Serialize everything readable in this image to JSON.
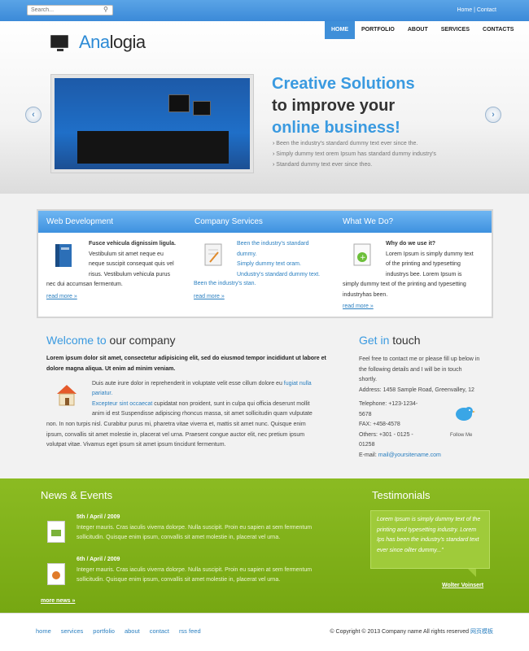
{
  "search": {
    "placeholder": "Search..."
  },
  "toplinks": {
    "home": "Home",
    "sep": " | ",
    "contact": "Contact"
  },
  "logo": {
    "part1": "Ana",
    "part2": "logia"
  },
  "nav": [
    "HOME",
    "PORTFOLIO",
    "ABOUT",
    "SERVICES",
    "CONTACTS"
  ],
  "hero": {
    "line1": "Creative Solutions",
    "line2": "to improve your",
    "line3": "online business!",
    "bullets": [
      "Been the industry's standard dummy text ever since the.",
      "Simply dummy text orem Ipsum has standard dummy industry's",
      "Standard dummy text ever since theo."
    ]
  },
  "box": {
    "web": {
      "title": "Web Development",
      "lead": "Fusce vehicula dignissim ligula.",
      "text1": "Vestibulum sit amet neque eu",
      "text2": "neque suscipit consequat quis vel",
      "text3": "risus. Vestibulum vehicula purus",
      "text4": "nec dui accumsan fermentum.",
      "more": "read more »"
    },
    "company": {
      "title": "Company Services",
      "links": [
        "Been the industry's standard",
        "dummy.",
        "Simply dummy text oram.",
        "Undustry's standard dummy text.",
        "Been the industry's stan."
      ],
      "more": "read more »"
    },
    "what": {
      "title": "What We Do?",
      "lead": "Why do we use it?",
      "text1": "Lorem Ipsum is simply dummy text",
      "text2": "of the printing and typesetting",
      "text3": "industrys bee. Lorem Ipsum is",
      "text4": "simply dummy text of the printing and typesetting",
      "text5": "industryhas been.",
      "more": "read more »"
    }
  },
  "welcome": {
    "title_a": "Welcome to",
    "title_b": " our company",
    "bold1": "Lorem ipsum dolor sit amet, consectetur adipisicing elit, sed do eiusmod tempor incididunt ut labore et",
    "bold2": "dolore magna aliqua. Ut enim ad minim veniam.",
    "p1": "Duis aute irure dolor in reprehenderit in voluptate velit esse cillum dolore eu ",
    "p1link": "fugiat nulla",
    "p1link2": "pariatur.",
    "p2link": "Excepteur sint occaecat",
    "p2": " cupidatat non proident, sunt in culpa qui officia deserunt mollit",
    "p3": "anim id est Suspendisse adipiscing rhoncus massa, sit amet sollicitudin quam vulputate",
    "p4": "non. In non turpis nisl. Curabitur purus mi, pharetra vitae viverra et, mattis sit amet nunc. Quisque enim",
    "p5": "ipsum, convallis sit amet molestie in, placerat vel urna. Praesent congue auctor elit, nec pretium ipsum",
    "p6": "volutpat vitae. Vivamus eget ipsum sit amet ipsum tincidunt fermentum."
  },
  "touch": {
    "title_a": "Get in",
    "title_b": " touch",
    "l1": "Feel free to contact me or please fill up below in",
    "l2": "the following details and I will be in touch",
    "l3": "shortly.",
    "l4": "Address: 1458 Sample Road, Greenvalley, 12",
    "tel1": "Telephone: +123-1234-",
    "tel2": "5678",
    "fax": "FAX: +458-4578",
    "oth1": "Others: +301 - 0125 -",
    "oth2": "01258",
    "email_label": "E-mail: ",
    "email": "mail@yoursitename.com",
    "follow": "Follow Me"
  },
  "news": {
    "title": "News & Events",
    "items": [
      {
        "date": "5th / April / 2009",
        "l1": "Integer mauris. Cras iaculis viverra dolorpe. Nulla suscipit. Proin eu sapien at sem fermentum",
        "l2": "sollicitudin. Quisque enim ipsum, convallis sit amet molestie in, placerat vel urna."
      },
      {
        "date": "6th / April / 2009",
        "l1": "Integer mauris. Cras iaculis viverra dolorpe. Nulla suscipit. Proin eu sapien at sem fermentum",
        "l2": "sollicitudin. Quisque enim ipsum, convallis sit amet molestie in, placerat vel urna."
      }
    ],
    "more": "more news »"
  },
  "testimonials": {
    "title": "Testimonials",
    "quote": "Lorem Ipsum is simply dummy text of the printing and typesetting industry. Lorem Ips has been the industry's standard text ever since oilter dummy...\"",
    "author": "Wolter Voinsert"
  },
  "footer": {
    "links": [
      "home",
      "services",
      "portfolio",
      "about",
      "contact",
      "rss feed"
    ],
    "copy": "© Copyright © 2013 Company name All rights reserved ",
    "copylink": "网页模板"
  },
  "colors": {
    "accent": "#3a9ae0",
    "green": "#82b41b",
    "topbar": "#4a98e0"
  }
}
